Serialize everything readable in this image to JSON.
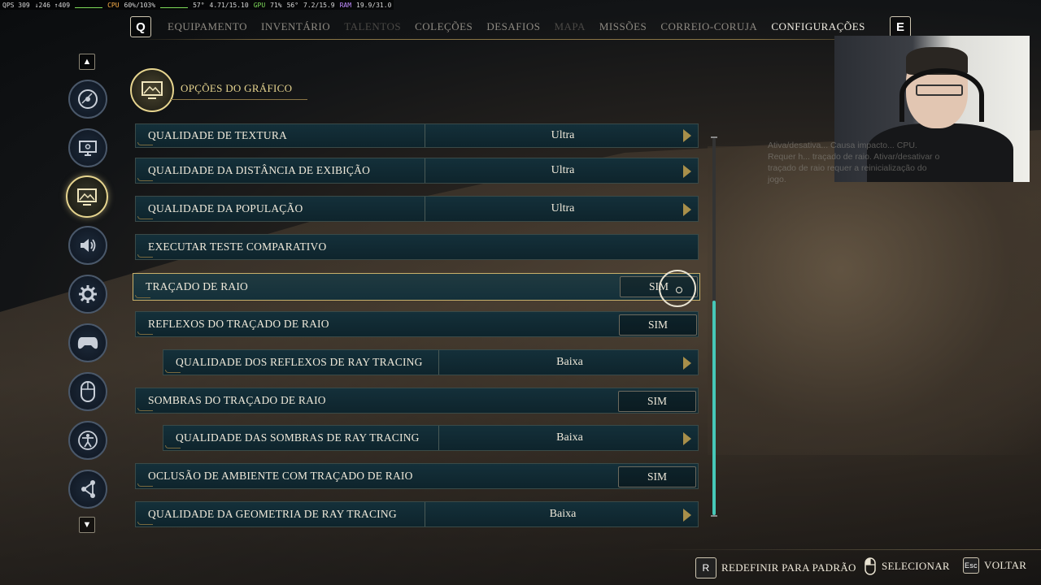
{
  "perf_overlay": {
    "fps": "QPS 309",
    "frametime": "↓246 ↑409",
    "cpu_label": "CPU",
    "cpu_value": "60%/103%",
    "cpu_temp": "57°",
    "cpu_clock": "4.71/15.10",
    "gpu_label": "GPU",
    "gpu_value": "71%",
    "gpu_temp": "56°",
    "gpu_mem": "7.2/15.9",
    "ram_label": "RAM",
    "ram_value": "19.9/31.0"
  },
  "topnav": {
    "left_key": "Q",
    "right_key": "E",
    "tabs": [
      {
        "label": "EQUIPAMENTO",
        "state": "normal"
      },
      {
        "label": "INVENTÁRIO",
        "state": "normal"
      },
      {
        "label": "TALENTOS",
        "state": "disabled"
      },
      {
        "label": "COLEÇÕES",
        "state": "normal"
      },
      {
        "label": "DESAFIOS",
        "state": "normal"
      },
      {
        "label": "MAPA",
        "state": "disabled"
      },
      {
        "label": "MISSÕES",
        "state": "normal"
      },
      {
        "label": "CORREIO-CORUJA",
        "state": "normal"
      },
      {
        "label": "CONFIGURAÇÕES",
        "state": "active"
      }
    ]
  },
  "sidebar": {
    "items": [
      {
        "icon": "disc-icon"
      },
      {
        "icon": "monitor-icon"
      },
      {
        "icon": "image-icon",
        "selected": true
      },
      {
        "icon": "speaker-icon"
      },
      {
        "icon": "cog-icon"
      },
      {
        "icon": "gamepad-icon"
      },
      {
        "icon": "mouse-icon"
      },
      {
        "icon": "accessibility-icon"
      },
      {
        "icon": "network-icon"
      }
    ]
  },
  "section": {
    "title": "OPÇÕES DO GRÁFICO"
  },
  "settings": [
    {
      "label": "QUALIDADE DE TEXTURA",
      "type": "select",
      "value": "Ultra"
    },
    {
      "label": "QUALIDADE DA DISTÂNCIA DE EXIBIÇÃO",
      "type": "select",
      "value": "Ultra"
    },
    {
      "label": "QUALIDADE DA POPULAÇÃO",
      "type": "select",
      "value": "Ultra"
    },
    {
      "label": "EXECUTAR TESTE COMPARATIVO",
      "type": "action",
      "value": ""
    },
    {
      "label": "TRAÇADO DE RAIO",
      "type": "toggle",
      "value": "SIM",
      "highlighted": true
    },
    {
      "label": "REFLEXOS DO TRAÇADO DE RAIO",
      "type": "toggle",
      "value": "SIM"
    },
    {
      "label": "QUALIDADE DOS REFLEXOS DE RAY TRACING",
      "type": "select",
      "value": "Baixa",
      "indented": true
    },
    {
      "label": "SOMBRAS DO TRAÇADO DE RAIO",
      "type": "toggle",
      "value": "SIM"
    },
    {
      "label": "QUALIDADE DAS SOMBRAS DE RAY TRACING",
      "type": "select",
      "value": "Baixa",
      "indented": true
    },
    {
      "label": "OCLUSÃO DE AMBIENTE COM TRAÇADO DE RAIO",
      "type": "toggle",
      "value": "SIM"
    },
    {
      "label": "QUALIDADE DA GEOMETRIA DE RAY TRACING",
      "type": "select",
      "value": "Baixa"
    }
  ],
  "tooltip": {
    "text": "Ativa/desativa... Causa impacto... CPU. Requer h... traçado de raio. Ativar/desativar o traçado de raio requer a reinicialização do jogo."
  },
  "footer": {
    "reset": {
      "key": "R",
      "label": "REDEFINIR PARA PADRÃO"
    },
    "select": {
      "key": "mouse-icon",
      "label": "SELECIONAR"
    },
    "back": {
      "key": "Esc",
      "label": "VOLTAR"
    }
  },
  "colors": {
    "accent_gold": "#e7d58f",
    "row_bg": "#0e242c",
    "scroll_thumb": "#46c8b8"
  }
}
